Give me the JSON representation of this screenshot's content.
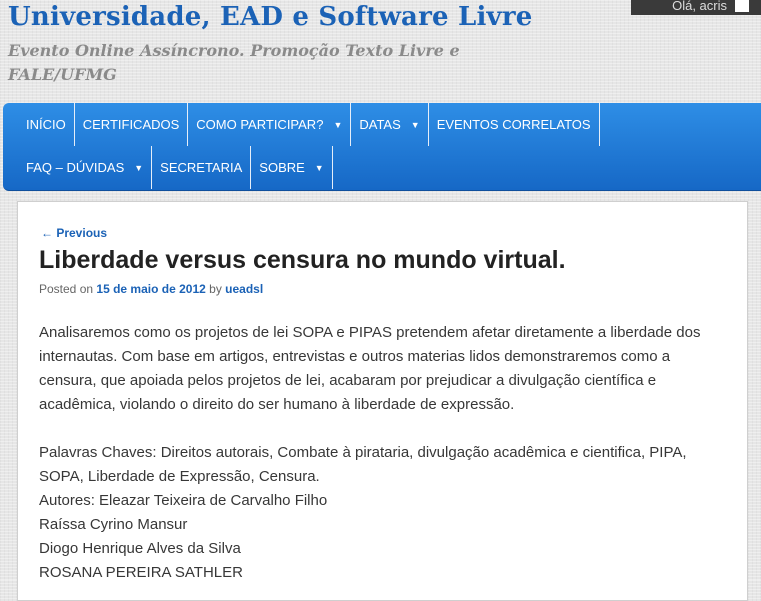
{
  "header": {
    "site_title": "Universidade, EAD e Software Livre",
    "site_description": "Evento Online Assíncrono. Promoção Texto Livre e FALE/UFMG"
  },
  "admin_bar": {
    "greeting": "Olá, acris"
  },
  "nav": {
    "row1": [
      {
        "label": "INÍCIO",
        "dropdown": false
      },
      {
        "label": "CERTIFICADOS",
        "dropdown": false
      },
      {
        "label": "COMO PARTICIPAR?",
        "dropdown": true
      },
      {
        "label": "DATAS",
        "dropdown": true
      },
      {
        "label": "EVENTOS CORRELATOS",
        "dropdown": false
      }
    ],
    "row2": [
      {
        "label": "FAQ – DÚVIDAS",
        "dropdown": true
      },
      {
        "label": "SECRETARIA",
        "dropdown": false
      },
      {
        "label": "SOBRE",
        "dropdown": true
      }
    ]
  },
  "post": {
    "prev_link": "← Previous",
    "title": "Liberdade versus censura no mundo virtual.",
    "meta": {
      "posted_on": "Posted on",
      "date": "15 de maio de 2012",
      "by": "by",
      "author": "ueadsl"
    },
    "paragraph1": "Analisaremos como os projetos de lei SOPA e PIPAS pretendem afetar diretamente a liberdade dos internautas. Com base em artigos, entrevistas e outros materias lidos demonstraremos como a censura, que apoiada pelos projetos de lei, acabaram por prejudicar a divulgação científica e acadêmica, violando o direito do ser humano à liberdade de expressão.",
    "keywords": "Palavras Chaves: Direitos autorais, Combate à pirataria, divulgação acadêmica e cientifica, PIPA, SOPA, Liberdade de Expressão, Censura.",
    "authors_label": "Autores: Eleazar Teixeira de Carvalho Filho",
    "authors": [
      "Raíssa Cyrino Mansur",
      "Diogo Henrique Alves da Silva",
      "ROSANA PEREIRA SATHLER"
    ]
  }
}
